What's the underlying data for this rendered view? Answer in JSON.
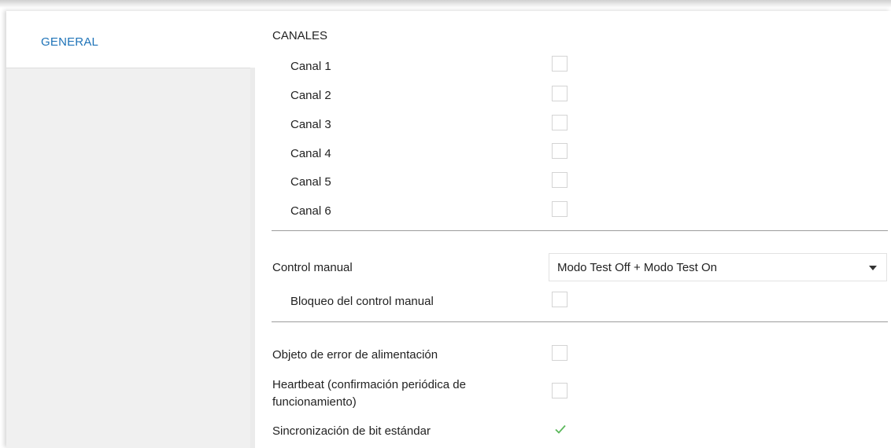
{
  "sidebar": {
    "tab_general": "GENERAL"
  },
  "channels": {
    "header": "CANALES",
    "items": [
      {
        "label": "Canal 1",
        "checked": false
      },
      {
        "label": "Canal 2",
        "checked": false
      },
      {
        "label": "Canal 3",
        "checked": false
      },
      {
        "label": "Canal 4",
        "checked": false
      },
      {
        "label": "Canal 5",
        "checked": false
      },
      {
        "label": "Canal 6",
        "checked": false
      }
    ]
  },
  "manual": {
    "label": "Control manual",
    "selected": "Modo Test Off + Modo Test On",
    "lock_label": "Bloqueo del control manual",
    "lock_checked": false
  },
  "misc": {
    "power_error_label": "Objeto de error de alimentación",
    "power_error_checked": false,
    "heartbeat_label_1": "Heartbeat (confirmación periódica de",
    "heartbeat_label_2": "funcionamiento)",
    "heartbeat_checked": false,
    "sync_label": "Sincronización de bit estándar",
    "sync_checked": true
  },
  "colors": {
    "accent": "#1e73b8",
    "check": "#5cb85c"
  }
}
